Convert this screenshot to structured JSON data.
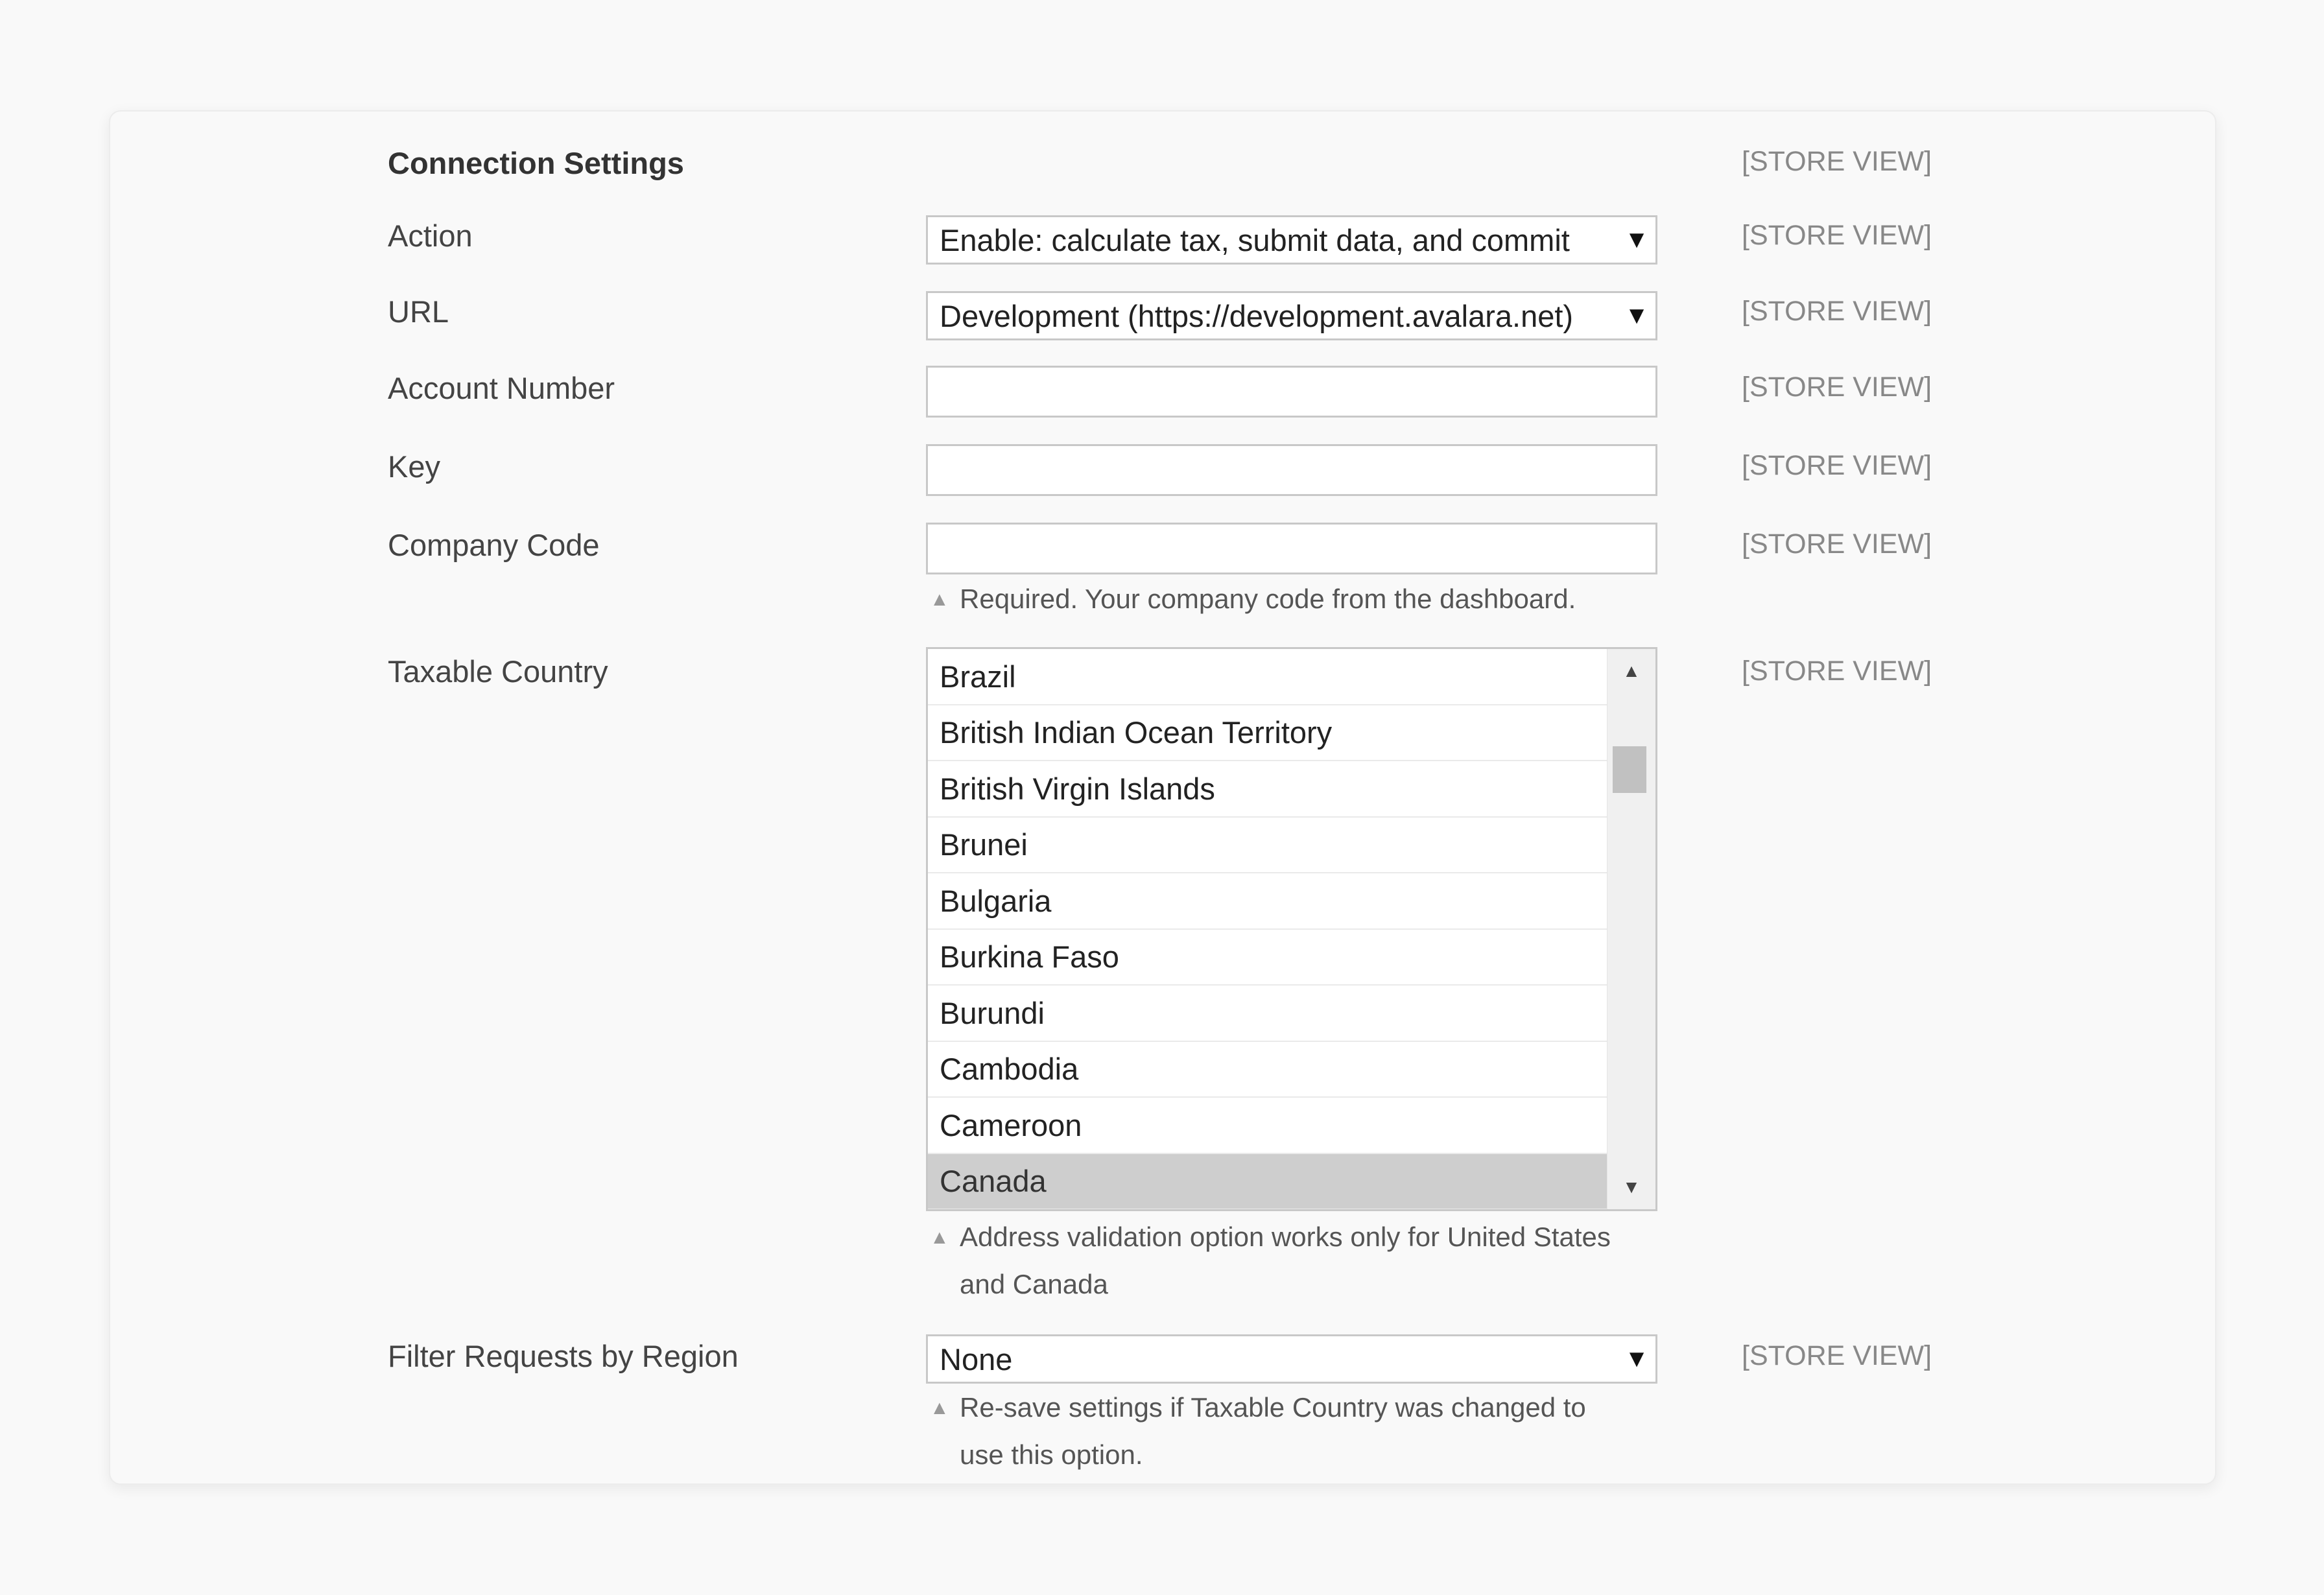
{
  "section": {
    "title": "Connection Settings",
    "scope_label": "[STORE VIEW]"
  },
  "fields": {
    "action": {
      "label": "Action",
      "value": "Enable: calculate tax, submit data, and commit",
      "scope": "[STORE VIEW]"
    },
    "url": {
      "label": "URL",
      "value": "Development (https://development.avalara.net)",
      "scope": "[STORE VIEW]"
    },
    "account_number": {
      "label": "Account Number",
      "value": "",
      "scope": "[STORE VIEW]"
    },
    "key": {
      "label": "Key",
      "value": "",
      "scope": "[STORE VIEW]"
    },
    "company_code": {
      "label": "Company Code",
      "value": "",
      "scope": "[STORE VIEW]",
      "hint": "Required. Your company code from the dashboard."
    },
    "taxable_country": {
      "label": "Taxable Country",
      "scope": "[STORE VIEW]",
      "options": [
        "Brazil",
        "British Indian Ocean Territory",
        "British Virgin Islands",
        "Brunei",
        "Bulgaria",
        "Burkina Faso",
        "Burundi",
        "Cambodia",
        "Cameroon",
        "Canada"
      ],
      "selected": "Canada",
      "hint_line1": "Address validation option works only for United States",
      "hint_line2": "and Canada"
    },
    "filter_region": {
      "label": "Filter Requests by Region",
      "value": "None",
      "scope": "[STORE VIEW]",
      "hint_line1": "Re-save settings if Taxable Country was changed to",
      "hint_line2": "use this option."
    }
  },
  "icons": {
    "dropdown": "triangle-down",
    "hint": "triangle-up",
    "scroll_up": "triangle-up",
    "scroll_down": "triangle-down"
  }
}
